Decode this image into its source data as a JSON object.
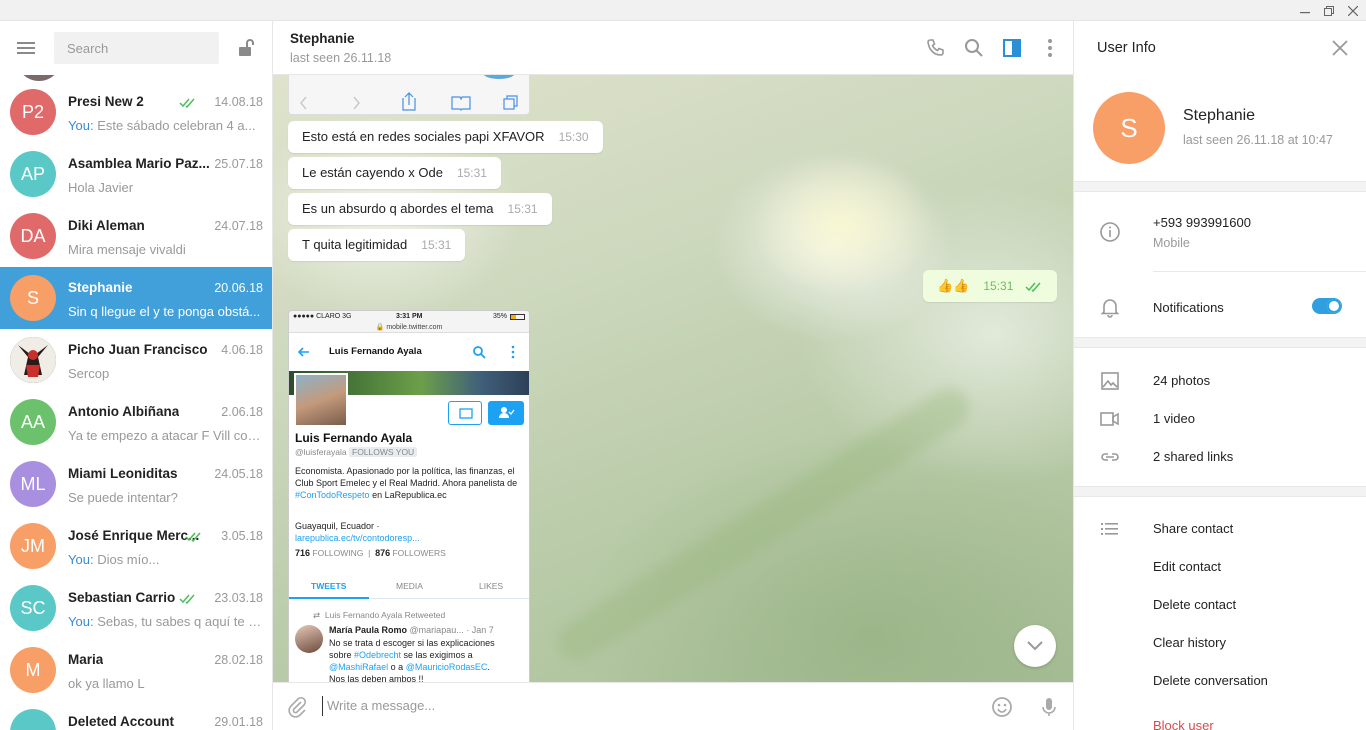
{
  "colors": {
    "accent": "#419fd9",
    "outgoing_bubble": "#effdde",
    "danger": "#d14e4e",
    "read_ticks": "#4dbd5a"
  },
  "left": {
    "search_placeholder": "Search",
    "chats": [
      {
        "initials": "P2",
        "color": "#e06a6a",
        "name": "Presi New 2",
        "date": "14.08.18",
        "ticks": true,
        "you": "You:",
        "preview": "Este sábado celebran 4 a..."
      },
      {
        "initials": "AP",
        "color": "#5bc8c8",
        "name": "Asamblea Mario Paz...",
        "date": "25.07.18",
        "ticks": false,
        "you": "",
        "preview": "Hola Javier"
      },
      {
        "initials": "DA",
        "color": "#e06a6a",
        "name": "Diki Aleman",
        "date": "24.07.18",
        "ticks": false,
        "you": "",
        "preview": "Mira mensaje vivaldi"
      },
      {
        "initials": "S",
        "color": "#f79f67",
        "name": "Stephanie",
        "date": "20.06.18",
        "ticks": false,
        "you": "",
        "preview": "Sin q llegue el y te ponga obstá...",
        "active": true
      },
      {
        "initials": "",
        "color": "#3a2a2a",
        "name": "Picho Juan Francisco",
        "date": "4.06.18",
        "ticks": false,
        "you": "",
        "preview": "Sercop",
        "photo": true
      },
      {
        "initials": "AA",
        "color": "#6cc26c",
        "name": "Antonio Albiñana",
        "date": "2.06.18",
        "ticks": false,
        "you": "",
        "preview": "Ya te empezo a atacar F Vill con..."
      },
      {
        "initials": "ML",
        "color": "#a98fe0",
        "name": "Miami Leoniditas",
        "date": "24.05.18",
        "ticks": false,
        "you": "",
        "preview": "Se puede intentar?"
      },
      {
        "initials": "JM",
        "color": "#f79f67",
        "name": "José Enrique Merc...",
        "date": "3.05.18",
        "ticks": true,
        "you": "You:",
        "preview": "Dios mío..."
      },
      {
        "initials": "SC",
        "color": "#5bc8c8",
        "name": "Sebastian Carrio",
        "date": "23.03.18",
        "ticks": true,
        "you": "You:",
        "preview": "Sebas, tu sabes q aquí te q..."
      },
      {
        "initials": "M",
        "color": "#f79f67",
        "name": "Maria",
        "date": "28.02.18",
        "ticks": false,
        "you": "",
        "preview": "ok ya llamo L"
      },
      {
        "initials": "",
        "color": "#5bc8c8",
        "name": "Deleted Account",
        "date": "29.01.18",
        "ticks": false,
        "you": "",
        "preview": ""
      }
    ]
  },
  "header": {
    "name": "Stephanie",
    "status": "last seen 26.11.18"
  },
  "messages": [
    {
      "text": "Esto está en redes sociales papi XFAVOR",
      "time": "15:30"
    },
    {
      "text": "Le están cayendo x Ode",
      "time": "15:31"
    },
    {
      "text": "Es un absurdo q abordes el tema",
      "time": "15:31"
    },
    {
      "text": "T quita legitimidad",
      "time": "15:31"
    },
    {
      "text": "👍👍",
      "time": "15:31",
      "out": true
    }
  ],
  "screenshot": {
    "carrier": "●●●●● CLARO  3G",
    "clock": "3:31 PM",
    "battery": "35%",
    "url": "🔒 mobile.twitter.com",
    "bar_title": "Luis Fernando Ayala",
    "name": "Luis Fernando Ayala",
    "handle": "@luisferayala",
    "follows_you": "FOLLOWS YOU",
    "bio_1": "Economista. Apasionado por la política, las finanzas, el Club Sport Emelec y el Real Madrid. Ahora panelista de ",
    "bio_link": "#ConTodoRespeto",
    "bio_2": " en LaRepublica.ec",
    "location": "Guayaquil, Ecuador  ·",
    "link": "larepublica.ec/tv/contodoresp...",
    "following_count": "716",
    "following_label": "FOLLOWING",
    "followers_count": "876",
    "followers_label": "FOLLOWERS",
    "tab_tweets": "TWEETS",
    "tab_media": "MEDIA",
    "tab_likes": "LIKES",
    "retweeted": "Luis Fernando Ayala Retweeted",
    "tweet_author": "María Paula Romo",
    "tweet_handle": "@mariapau...",
    "tweet_date": "· Jan 7",
    "tweet_line1": "No se trata d escoger si las explicaciones",
    "tweet_line2a": "sobre ",
    "tweet_line2_link": "#Odebrecht",
    "tweet_line2b": " se las exigimos a",
    "tweet_line3_link1": "@MashiRafael",
    "tweet_line3_mid": " o a ",
    "tweet_line3_link2": "@MauricioRodasEC",
    "tweet_line3_end": ".",
    "tweet_line4": "Nos las deben ambos !!"
  },
  "composer": {
    "placeholder": "Write a message..."
  },
  "info": {
    "title": "User Info",
    "initial": "S",
    "name": "Stephanie",
    "status": "last seen 26.11.18 at 10:47",
    "phone": "+593 993991600",
    "phone_label": "Mobile",
    "notifications": "Notifications",
    "notifications_on": true,
    "photos": "24 photos",
    "video": "1 video",
    "links": "2 shared links",
    "actions": [
      "Share contact",
      "Edit contact",
      "Delete contact",
      "Clear history",
      "Delete conversation",
      "Block user"
    ]
  }
}
